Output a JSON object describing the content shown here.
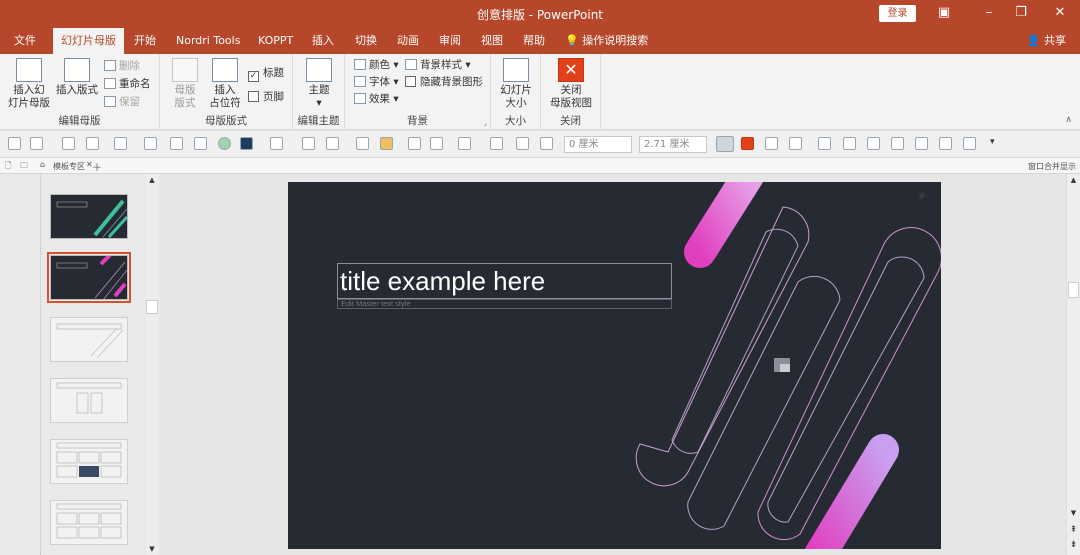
{
  "window": {
    "title": "创意排版 - PowerPoint",
    "login_label": "登录"
  },
  "tabs": [
    {
      "label": "文件"
    },
    {
      "label": "幻灯片母版"
    },
    {
      "label": "开始"
    },
    {
      "label": "Nordri Tools"
    },
    {
      "label": "KOPPT"
    },
    {
      "label": "插入"
    },
    {
      "label": "切换"
    },
    {
      "label": "动画"
    },
    {
      "label": "审阅"
    },
    {
      "label": "视图"
    },
    {
      "label": "帮助"
    },
    {
      "label": "操作说明搜索"
    }
  ],
  "share_label": "共享",
  "ribbon": {
    "edit_master": {
      "label": "编辑母版",
      "insert_master": "插入幻\n灯片母版",
      "insert_layout": "插入版式",
      "delete": "删除",
      "rename": "重命名",
      "preserve": "保留"
    },
    "master_layout": {
      "label": "母版版式",
      "master_layout_btn": "母版\n版式",
      "insert_placeholder": "插入\n占位符",
      "title_chk": "标题",
      "footer_chk": "页脚"
    },
    "edit_theme": {
      "label": "编辑主题",
      "themes": "主题"
    },
    "background": {
      "label": "背景",
      "colors": "颜色",
      "fonts": "字体",
      "effects": "效果",
      "bg_styles": "背景样式",
      "hide_bg": "隐藏背景图形"
    },
    "size": {
      "label": "大小",
      "slide_size": "幻灯片\n大小"
    },
    "close": {
      "label": "关闭",
      "close_master": "关闭\n母版视图"
    }
  },
  "toolbar": {
    "width_value": "0 厘米",
    "height_value": "2.71 厘米"
  },
  "tabsbar": {
    "template_tab": "模板专区",
    "right_label": "窗口合并显示"
  },
  "slide": {
    "title": "title example here",
    "subtitle": "Edit Master text style"
  },
  "thumbnails": [
    {
      "kind": "dark"
    },
    {
      "kind": "dark",
      "selected": true
    },
    {
      "kind": "light"
    },
    {
      "kind": "light"
    },
    {
      "kind": "light"
    },
    {
      "kind": "light"
    }
  ],
  "colors": {
    "accent": "#b7472a",
    "slide_bg": "#262a33",
    "pink": "#e040c0"
  }
}
